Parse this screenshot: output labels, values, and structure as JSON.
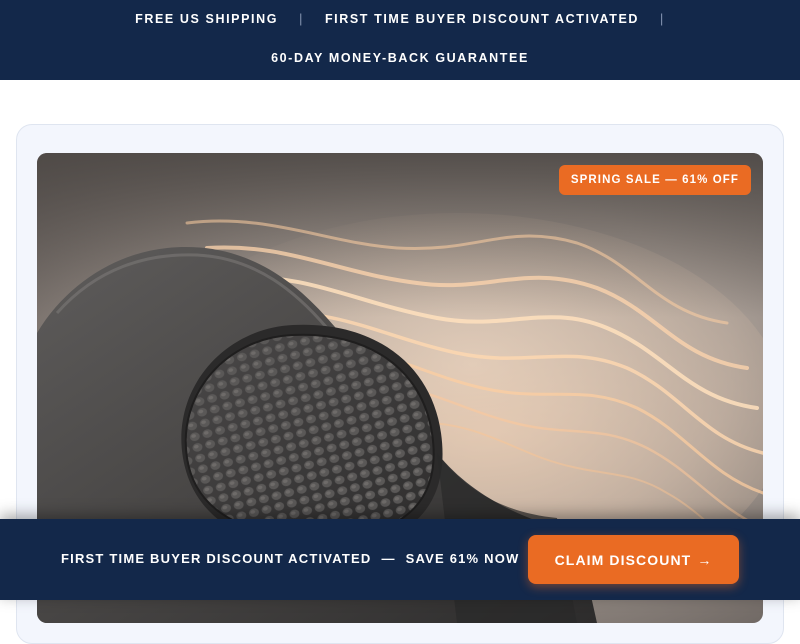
{
  "announcement_bar": {
    "items": [
      "FREE US SHIPPING",
      "FIRST TIME BUYER DISCOUNT ACTIVATED",
      "60-DAY MONEY-BACK GUARANTEE"
    ],
    "separator": "|"
  },
  "product": {
    "image_subject": "heated neck massager with textured pad",
    "sale_badge": "SPRING SALE — 61% OFF"
  },
  "sticky_bar": {
    "message": "FIRST TIME BUYER DISCOUNT ACTIVATED",
    "dash": "—",
    "offer": "SAVE 61% NOW",
    "button_label": "CLAIM DISCOUNT",
    "button_arrow": "→"
  },
  "colors": {
    "navy": "#13284a",
    "accent_orange": "#ea6b23",
    "card_background": "#f3f6fd"
  }
}
